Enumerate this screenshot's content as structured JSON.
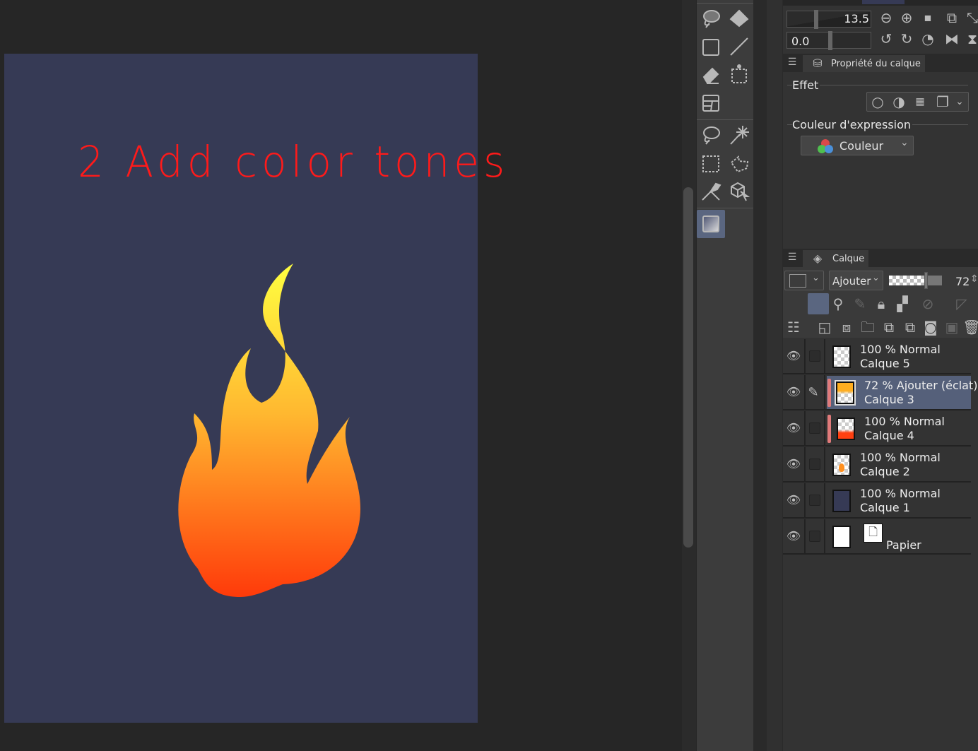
{
  "canvas": {
    "annotation": "2 Add color tones",
    "bg_color": "#363a55",
    "note_color": "#ff1a1a"
  },
  "navigator": {
    "zoom_value": "13.5",
    "rotation_value": "0.0"
  },
  "layer_property": {
    "tab_label": "Propriété du calque",
    "effect_label": "Effet",
    "expression_color_label": "Couleur d'expression",
    "expression_color_value": "Couleur"
  },
  "layers_panel": {
    "tab_label": "Calque",
    "blend_mode": "Ajouter",
    "opacity": "72",
    "opacity_fraction": 0.72,
    "layers": [
      {
        "opacity": "100 %",
        "mode": "Normal",
        "name": "Calque 5"
      },
      {
        "opacity": "72 %",
        "mode": "Ajouter (éclat)",
        "name": "Calque 3",
        "selected": true
      },
      {
        "opacity": "100 %",
        "mode": "Normal",
        "name": "Calque 4"
      },
      {
        "opacity": "100 %",
        "mode": "Normal",
        "name": "Calque 2"
      },
      {
        "opacity": "100 %",
        "mode": "Normal",
        "name": "Calque 1"
      },
      {
        "name": "Papier"
      }
    ]
  }
}
